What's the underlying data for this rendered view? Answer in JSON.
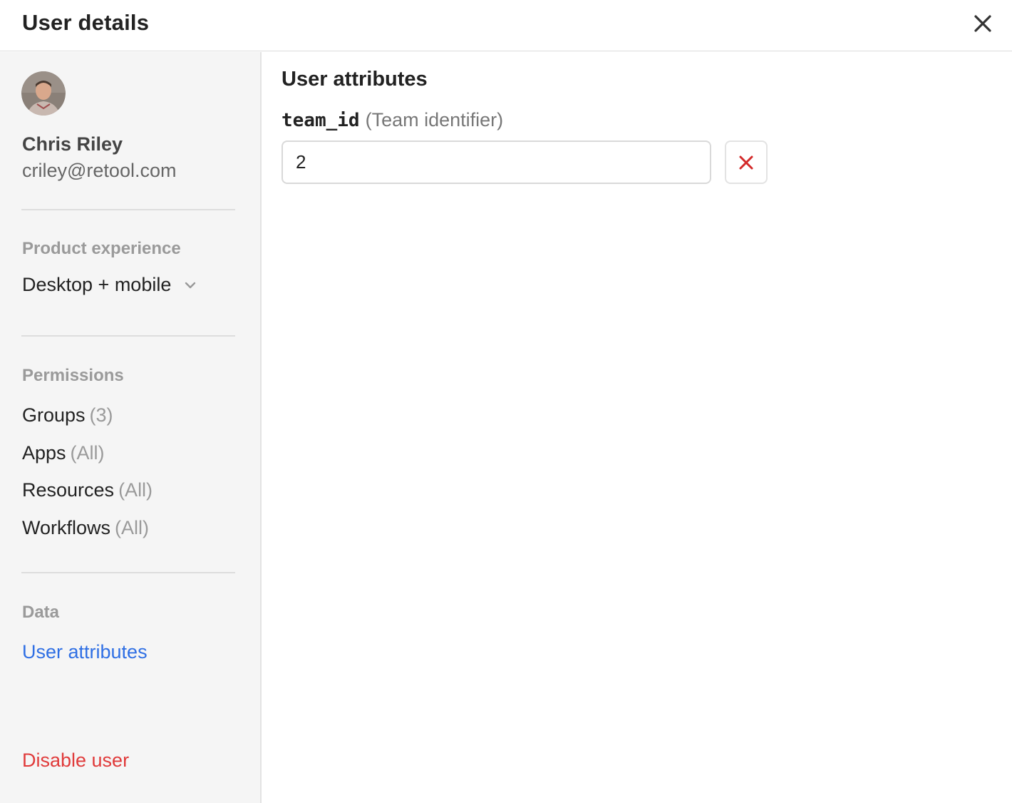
{
  "header": {
    "title": "User details",
    "close_icon": "close-icon"
  },
  "user": {
    "name": "Chris Riley",
    "email": "criley@retool.com"
  },
  "product_experience": {
    "label": "Product experience",
    "selected": "Desktop + mobile"
  },
  "permissions": {
    "label": "Permissions",
    "items": [
      {
        "label": "Groups",
        "count": "(3)"
      },
      {
        "label": "Apps",
        "count": "(All)"
      },
      {
        "label": "Resources",
        "count": "(All)"
      },
      {
        "label": "Workflows",
        "count": "(All)"
      }
    ]
  },
  "data_section": {
    "label": "Data",
    "items": [
      {
        "label": "User attributes"
      }
    ]
  },
  "disable_user": "Disable user",
  "main": {
    "heading": "User attributes",
    "attribute": {
      "key": "team_id",
      "description": "(Team identifier)",
      "value": "2"
    }
  },
  "colors": {
    "accent": "#2f6fe4",
    "danger": "#e03a3a",
    "sidebar_bg": "#f5f5f5"
  }
}
